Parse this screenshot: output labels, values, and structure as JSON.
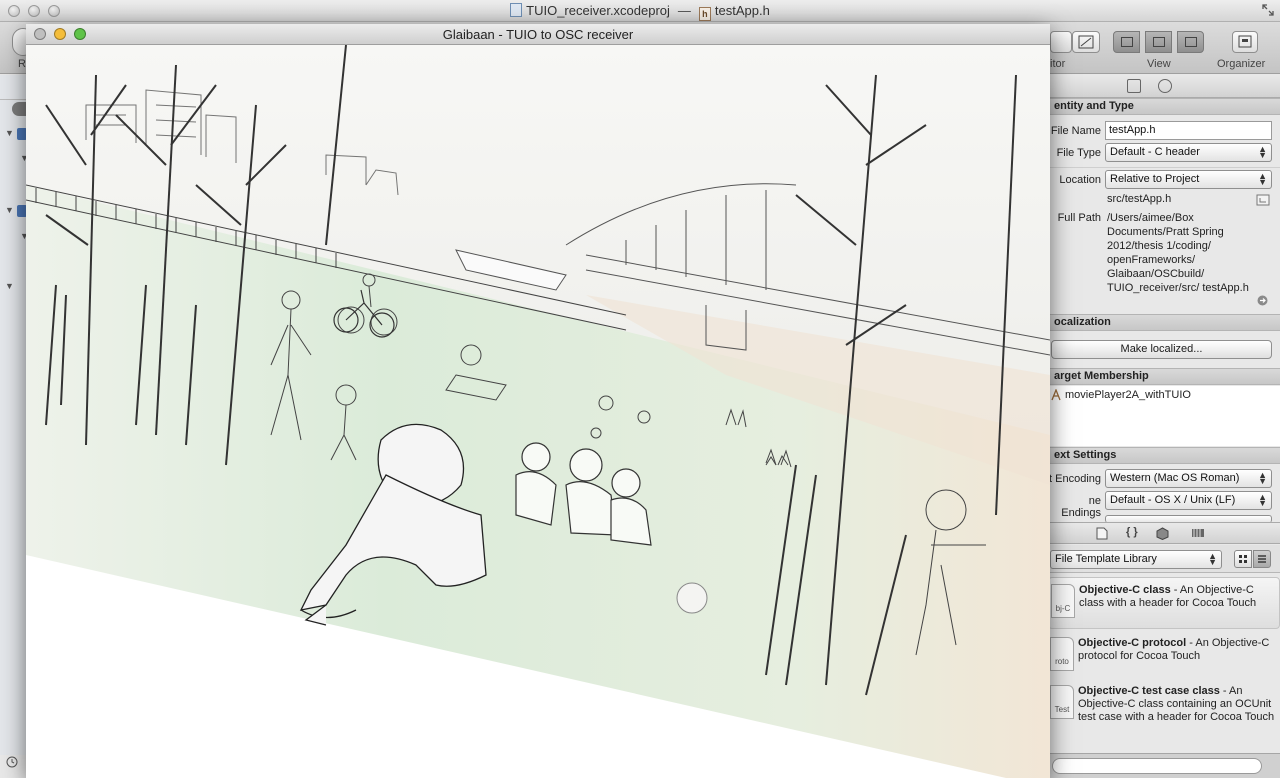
{
  "xcode": {
    "window_title_project": "TUIO_receiver.xcodeproj",
    "window_title_sep": "—",
    "window_title_file": "testApp.h",
    "toolbar": {
      "run_label": "R",
      "editor_label": "itor",
      "view_label": "View",
      "organizer_label": "Organizer"
    }
  },
  "inspector": {
    "identity": {
      "header": "entity and Type",
      "file_name_label": "File Name",
      "file_name_value": "testApp.h",
      "file_type_label": "File Type",
      "file_type_value": "Default - C header",
      "location_label": "Location",
      "location_value": "Relative to Project",
      "relative_path": "src/testApp.h",
      "full_path_label": "Full Path",
      "full_path_value": "/Users/aimee/Box Documents/Pratt Spring 2012/thesis 1/coding/ openFrameworks/ Glaibaan/OSCbuild/ TUIO_receiver/src/ testApp.h"
    },
    "localization": {
      "header": "ocalization",
      "button": "Make localized..."
    },
    "target_membership": {
      "header": "arget Membership",
      "target": "moviePlayer2A_withTUIO"
    },
    "text_settings": {
      "header": "ext Settings",
      "encoding_label": "t Encoding",
      "encoding_value": "Western (Mac OS Roman)",
      "line_endings_label": "ne Endings",
      "line_endings_value": "Default - OS X / Unix (LF)"
    },
    "library": {
      "popup_value": "File Template Library",
      "items": [
        {
          "icon_text": "bj-C",
          "title": "Objective-C class",
          "desc": " - An Objective-C class with a header for Cocoa Touch"
        },
        {
          "icon_text": "roto",
          "title": "Objective-C protocol",
          "desc": " - An Objective-C protocol for Cocoa Touch"
        },
        {
          "icon_text": "Test",
          "title": "Objective-C test case class",
          "desc": " - An Objective-C class containing an OCUnit test case with a header for Cocoa Touch"
        }
      ]
    }
  },
  "tuio_window": {
    "title": "Glaibaan - TUIO to OSC receiver",
    "illustration": "pencil-sketch-park-scene"
  },
  "colors": {
    "close_red": "#ec5b55",
    "minimize_yellow": "#f4bd3a",
    "zoom_green": "#5fc348",
    "grass_green": "#dfeede",
    "sky_white": "#f4f4f2"
  }
}
